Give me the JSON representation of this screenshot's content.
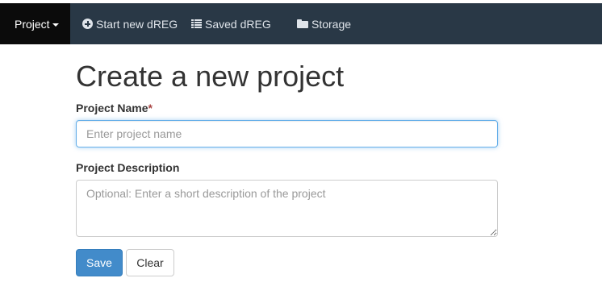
{
  "navbar": {
    "project_label": "Project",
    "items": [
      {
        "label": "Start new dREG",
        "icon": "plus-circle-icon"
      },
      {
        "label": "Saved dREG",
        "icon": "list-icon"
      },
      {
        "label": "Storage",
        "icon": "folder-icon"
      }
    ],
    "colors": {
      "background": "#293846",
      "active": "#0b0b0b"
    }
  },
  "page": {
    "title": "Create a new project"
  },
  "form": {
    "name_label": "Project Name",
    "name_required_mark": "*",
    "name_placeholder": "Enter project name",
    "name_value": "",
    "description_label": "Project Description",
    "description_placeholder": "Optional: Enter a short description of the project",
    "description_value": ""
  },
  "buttons": {
    "save_label": "Save",
    "clear_label": "Clear",
    "save_color": "#428bca"
  }
}
